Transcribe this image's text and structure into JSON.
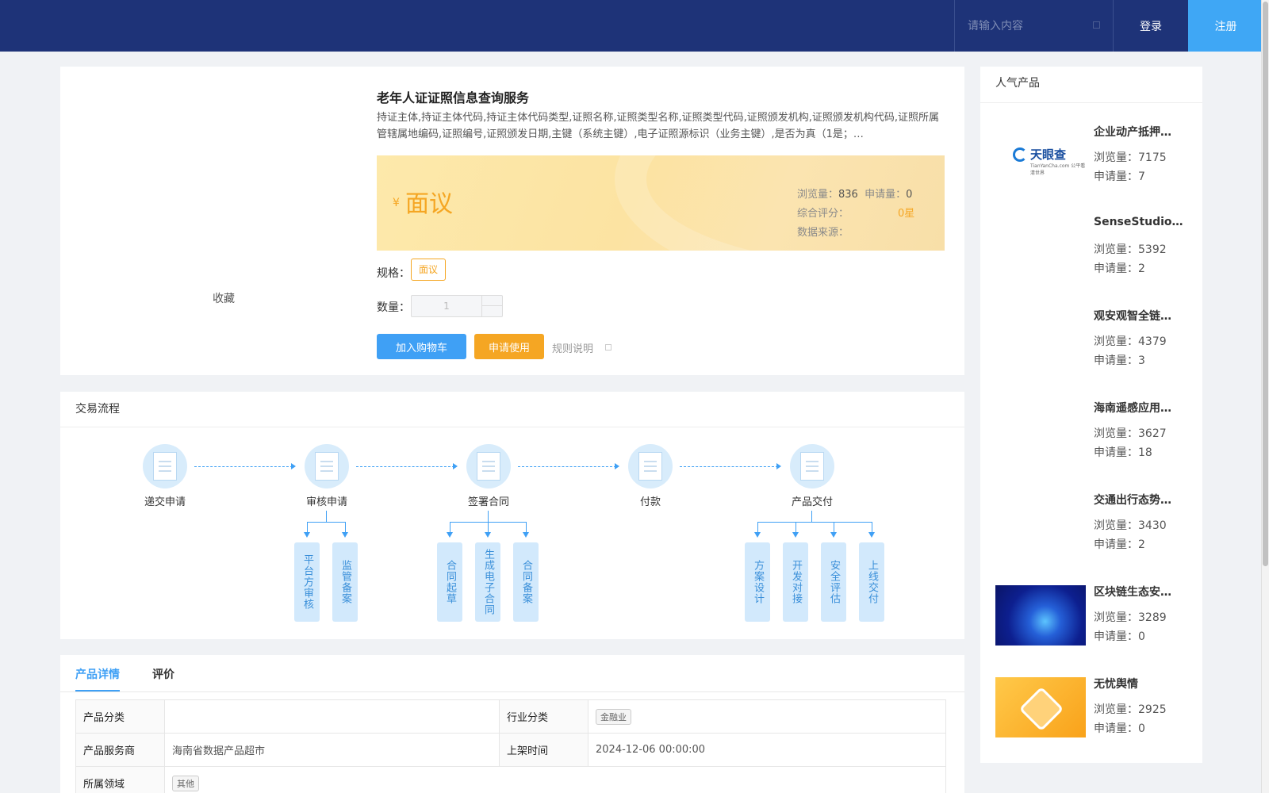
{
  "header": {
    "search_placeholder": "请输入内容",
    "login": "登录",
    "register": "注册"
  },
  "product": {
    "favorite": "收藏",
    "title": "老年人证证照信息查询服务",
    "description": "持证主体,持证主体代码,持证主体代码类型,证照名称,证照类型名称,证照类型代码,证照颁发机构,证照颁发机构代码,证照所属管辖属地编码,证照编号,证照颁发日期,主键（系统主键）,电子证照源标识（业务主键）,是否为真（1是；…",
    "currency": "¥",
    "price": "面议",
    "views_label": "浏览量：",
    "views": "836",
    "applies_label": "申请量：",
    "applies": "0",
    "rating_label": "综合评分：",
    "rating": "0星",
    "source_label": "数据来源：",
    "spec_label": "规格：",
    "spec_value": "面议",
    "qty_label": "数量：",
    "qty_value": "1",
    "add_cart": "加入购物车",
    "apply": "申请使用",
    "rules": "规则说明"
  },
  "flow": {
    "title": "交易流程",
    "steps": [
      "递交申请",
      "审核申请",
      "签署合同",
      "付款",
      "产品交付"
    ],
    "substeps": {
      "review": [
        "平台方审核",
        "监管备案"
      ],
      "contract": [
        "合同起草",
        "生成电子合同",
        "合同备案"
      ],
      "delivery": [
        "方案设计",
        "开发对接",
        "安全评估",
        "上线交付"
      ]
    }
  },
  "details": {
    "tabs": [
      "产品详情",
      "评价"
    ],
    "rows": {
      "category_label": "产品分类",
      "category_value": "",
      "industry_label": "行业分类",
      "industry_value": "金融业",
      "provider_label": "产品服务商",
      "provider_value": "海南省数据产品超市",
      "listed_label": "上架时间",
      "listed_value": "2024-12-06 00:00:00",
      "domain_label": "所属领域",
      "domain_value": "其他"
    }
  },
  "popular": {
    "title": "人气产品",
    "views_label": "浏览量：",
    "applies_label": "申请量：",
    "items": [
      {
        "name": "企业动产抵押…",
        "views": "7175",
        "applies": "7",
        "logo": "天眼查",
        "logo_sub": "TianYanCha.com  公平看清世界"
      },
      {
        "name": "SenseStudio…",
        "views": "5392",
        "applies": "2"
      },
      {
        "name": "观安观智全链…",
        "views": "4379",
        "applies": "3"
      },
      {
        "name": "海南遥感应用…",
        "views": "3627",
        "applies": "18"
      },
      {
        "name": "交通出行态势…",
        "views": "3430",
        "applies": "2"
      },
      {
        "name": "区块链生态安…",
        "views": "3289",
        "applies": "0"
      },
      {
        "name": "无忧舆情",
        "views": "2925",
        "applies": "0"
      }
    ]
  }
}
